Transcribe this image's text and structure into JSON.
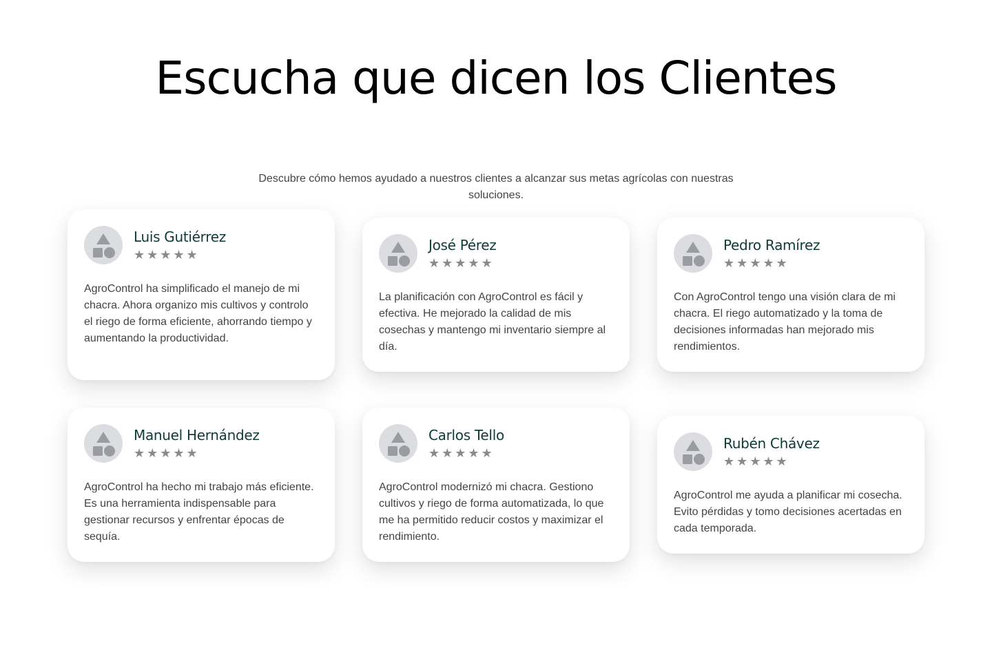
{
  "section": {
    "title": "Escucha que dicen los Clientes",
    "subtitle": "Descubre cómo hemos ayudado a nuestros clientes a alcanzar sus metas agrícolas con nuestras soluciones."
  },
  "testimonials": [
    {
      "name": "Luis Gutiérrez",
      "rating": 5,
      "stars": "★★★★★",
      "quote": "AgroControl ha simplificado el manejo de mi chacra. Ahora organizo mis cultivos y controlo el riego de forma eficiente, ahorrando tiempo y aumentando la productividad."
    },
    {
      "name": "José Pérez",
      "rating": 5,
      "stars": "★★★★★",
      "quote": "La planificación con AgroControl es fácil y efectiva. He mejorado la calidad de mis cosechas y mantengo mi inventario siempre al día."
    },
    {
      "name": "Pedro Ramírez",
      "rating": 5,
      "stars": "★★★★★",
      "quote": "Con AgroControl tengo una visión clara de mi chacra. El riego automatizado y la toma de decisiones informadas han mejorado mis rendimientos."
    },
    {
      "name": "Manuel Hernández",
      "rating": 5,
      "stars": "★★★★★",
      "quote": "AgroControl ha hecho mi trabajo más eficiente. Es una herramienta indispensable para gestionar recursos y enfrentar épocas de sequía."
    },
    {
      "name": "Carlos Tello",
      "rating": 5,
      "stars": "★★★★★",
      "quote": "AgroControl modernizó mi chacra. Gestiono cultivos y riego de forma automatizada, lo que me ha permitido reducir costos y maximizar el rendimiento."
    },
    {
      "name": "Rubén Chávez",
      "rating": 5,
      "stars": "★★★★★",
      "quote": "AgroControl me ayuda a planificar mi cosecha. Evito pérdidas y tomo decisiones acertadas en cada temporada."
    }
  ],
  "colors": {
    "name": "#0f3b36",
    "star": "#8a8a8a",
    "avatar_bg": "#dcdde0",
    "avatar_shape": "#9a9ca1"
  },
  "icons": {
    "avatar": "shapes-placeholder-icon",
    "star": "star-icon"
  }
}
